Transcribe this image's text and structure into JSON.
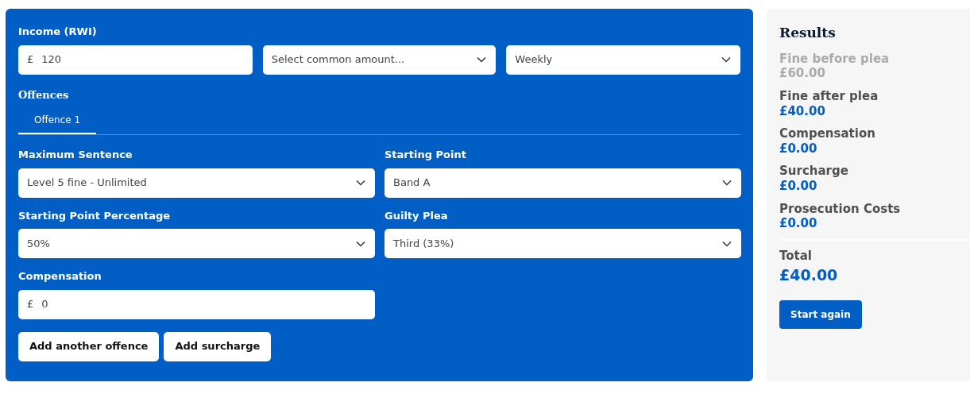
{
  "income": {
    "label": "Income (RWI)",
    "currency": "£",
    "value": "120",
    "common_amount": {
      "placeholder": "Select common amount..."
    },
    "period": {
      "value": "Weekly"
    }
  },
  "offences": {
    "heading": "Offences",
    "tabs": [
      {
        "label": "Offence 1",
        "selected": true
      }
    ],
    "fields": [
      {
        "kind": "select",
        "label": "Maximum Sentence",
        "value": "Level 5 fine - Unlimited"
      },
      {
        "kind": "select",
        "label": "Starting Point",
        "value": "Band A"
      },
      {
        "kind": "select",
        "label": "Starting Point Percentage",
        "value": "50%"
      },
      {
        "kind": "select",
        "label": "Guilty Plea",
        "value": "Third (33%)"
      },
      {
        "kind": "money",
        "label": "Compensation",
        "currency": "£",
        "value": "0"
      }
    ]
  },
  "buttons": [
    "Add another offence",
    "Add surcharge"
  ],
  "results": {
    "title": "Results",
    "items": [
      {
        "label": "Fine before plea",
        "value": "£60.00",
        "muted": true
      },
      {
        "label": "Fine after plea",
        "value": "£40.00",
        "muted": false
      },
      {
        "label": "Compensation",
        "value": "£0.00",
        "muted": false
      },
      {
        "label": "Surcharge",
        "value": "£0.00",
        "muted": false
      },
      {
        "label": "Prosecution Costs",
        "value": "£0.00",
        "muted": false
      }
    ],
    "total": {
      "label": "Total",
      "value": "£40.00"
    },
    "button": "Start again"
  }
}
